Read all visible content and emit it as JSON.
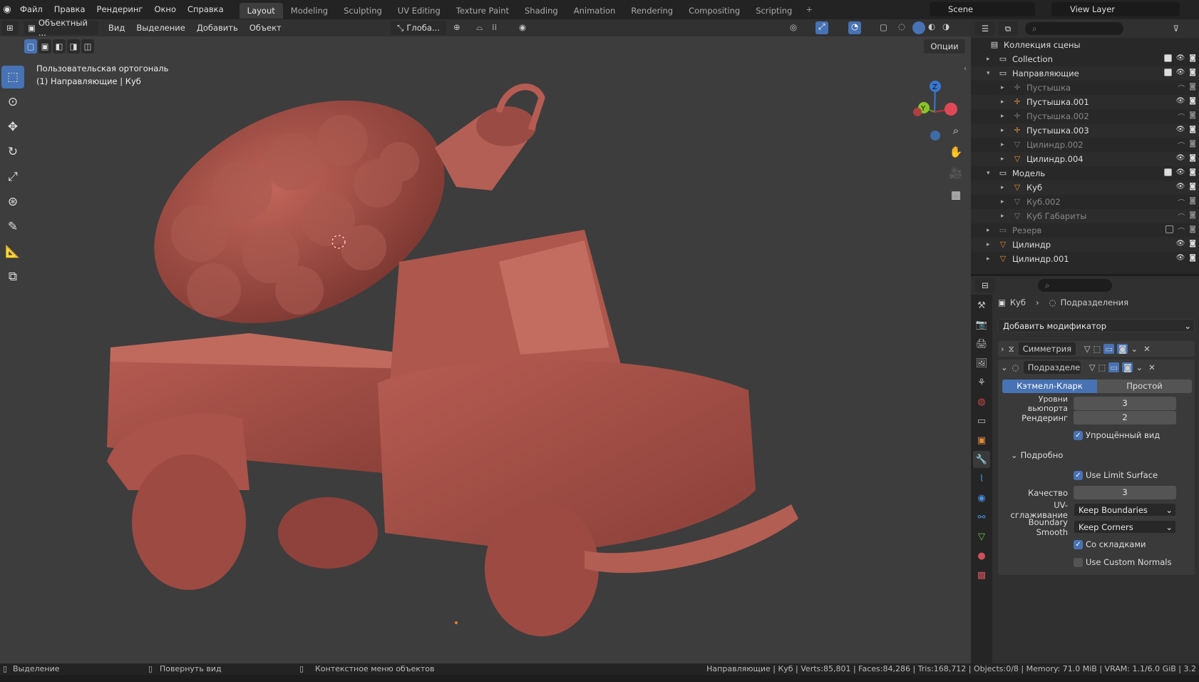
{
  "menubar": {
    "items": [
      "Файл",
      "Правка",
      "Рендеринг",
      "Окно",
      "Справка"
    ],
    "workspaces": [
      "Layout",
      "Modeling",
      "Sculpting",
      "UV Editing",
      "Texture Paint",
      "Shading",
      "Animation",
      "Rendering",
      "Compositing",
      "Scripting"
    ],
    "active_workspace": "Layout",
    "add_tab": "+",
    "scene": "Scene",
    "view_layer": "View Layer"
  },
  "viewport": {
    "mode": "Объектный ...",
    "menus": [
      "Вид",
      "Выделение",
      "Добавить",
      "Объект"
    ],
    "transform": "Глоба...",
    "options": "Опции",
    "info_line1": "Пользовательская ортогональ",
    "info_line2": "(1) Направляющие | Куб",
    "gizmo_axes": {
      "z": "Z",
      "y": "Y",
      "x": "X"
    }
  },
  "outliner": {
    "root": "Коллекция сцены",
    "rows": [
      {
        "label": "Collection",
        "indent": 0,
        "type": "collection",
        "dim": false
      },
      {
        "label": "Направляющие",
        "indent": 0,
        "type": "collection",
        "dim": false,
        "open": true
      },
      {
        "label": "Пустышка",
        "indent": 1,
        "type": "empty",
        "dim": true
      },
      {
        "label": "Пустышка.001",
        "indent": 1,
        "type": "empty",
        "dim": false
      },
      {
        "label": "Пустышка.002",
        "indent": 1,
        "type": "empty",
        "dim": true
      },
      {
        "label": "Пустышка.003",
        "indent": 1,
        "type": "empty",
        "dim": false
      },
      {
        "label": "Цилиндр.002",
        "indent": 1,
        "type": "mesh",
        "dim": true
      },
      {
        "label": "Цилиндр.004",
        "indent": 1,
        "type": "mesh",
        "dim": false
      },
      {
        "label": "Модель",
        "indent": 0,
        "type": "collection",
        "dim": false,
        "open": true
      },
      {
        "label": "Куб",
        "indent": 1,
        "type": "mesh",
        "dim": false
      },
      {
        "label": "Куб.002",
        "indent": 1,
        "type": "mesh",
        "dim": true
      },
      {
        "label": "Куб Габариты",
        "indent": 1,
        "type": "mesh",
        "dim": true
      },
      {
        "label": "Резерв",
        "indent": 0,
        "type": "collection",
        "dim": true
      },
      {
        "label": "Цилиндр",
        "indent": 0,
        "type": "mesh",
        "dim": false
      },
      {
        "label": "Цилиндр.001",
        "indent": 0,
        "type": "mesh",
        "dim": false
      }
    ]
  },
  "properties": {
    "breadcrumb_object": "Куб",
    "breadcrumb_modifier": "Подразделения",
    "add_modifier": "Добавить модификатор",
    "modifiers": [
      {
        "name": "Симметрия",
        "expanded": false
      },
      {
        "name": "Подразделе...",
        "expanded": true
      }
    ],
    "tabs": [
      "Кэтмелл-Кларк",
      "Простой"
    ],
    "levels_viewport_label": "Уровни вьюпорта",
    "levels_viewport": "3",
    "render_label": "Рендеринг",
    "render": "2",
    "optimal_display": "Упрощённый вид",
    "advanced": "Подробно",
    "use_limit_surface": "Use Limit Surface",
    "quality_label": "Качество",
    "quality": "3",
    "uv_smooth_label": "UV-сглаживание",
    "uv_smooth": "Keep Boundaries",
    "boundary_smooth_label": "Boundary Smooth",
    "boundary_smooth": "Keep Corners",
    "use_creases": "Со складками",
    "use_custom_normals": "Use Custom Normals"
  },
  "statusbar": {
    "left1": "Выделение",
    "left2": "Повернуть вид",
    "left3": "Контекстное меню объектов",
    "right": "Направляющие | Куб | Verts:85,801 | Faces:84,286 | Tris:168,712 | Objects:0/8 | Memory: 71.0 MiB | VRAM: 1.1/6.0 GiB | 3.2"
  },
  "colors": {
    "accent": "#4772b3",
    "model": "#a5524a",
    "viewport_bg": "#3d3d3d"
  }
}
